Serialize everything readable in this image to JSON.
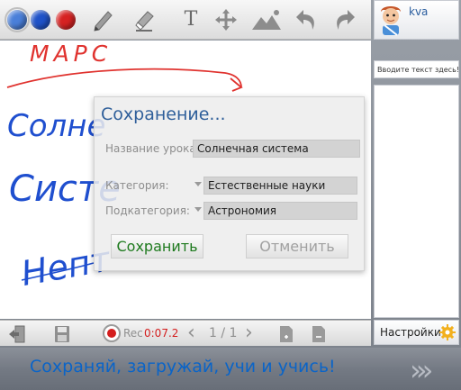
{
  "toolbar": {
    "colors": [
      {
        "name": "blue-light",
        "hex": "#4a7fd9",
        "selected": true
      },
      {
        "name": "blue",
        "hex": "#1f52c8",
        "selected": false
      },
      {
        "name": "red",
        "hex": "#d62222",
        "selected": false
      }
    ],
    "tools": [
      "pencil-icon",
      "eraser-icon",
      "text-tool-icon",
      "move-icon",
      "image-icon",
      "undo-icon",
      "redo-icon"
    ],
    "text_tool_label": "T"
  },
  "canvas": {
    "handwriting": {
      "word1": "МАРС",
      "word2": "Солне",
      "word3": "Систе",
      "word4": "Непт"
    },
    "ink_colors": {
      "red": "#e0332f",
      "blue": "#1f4fcf"
    }
  },
  "dialog": {
    "title": "Сохранение...",
    "lesson_name_label": "Название урока:",
    "lesson_name_value": "Солнечная система",
    "category_label": "Категория:",
    "category_value": "Естественные науки",
    "subcategory_label": "Подкатегория:",
    "subcategory_value": "Астрономия",
    "save_label": "Сохранить",
    "cancel_label": "Отменить",
    "save_color": "#1e7a1e",
    "cancel_color": "#a0a0a0"
  },
  "bottombar": {
    "rec_label": "Rec",
    "rec_time": "0:07.2",
    "page_indicator": "1 / 1",
    "prev_symbol": "‹",
    "next_symbol": "›"
  },
  "sidepanel": {
    "username": "kva",
    "chat_placeholder": "Вводите текст здесь!",
    "settings_label": "Настройки"
  },
  "footer": {
    "slogan": "Сохраняй, загружай, учи и учись!",
    "arrows": "›››"
  }
}
